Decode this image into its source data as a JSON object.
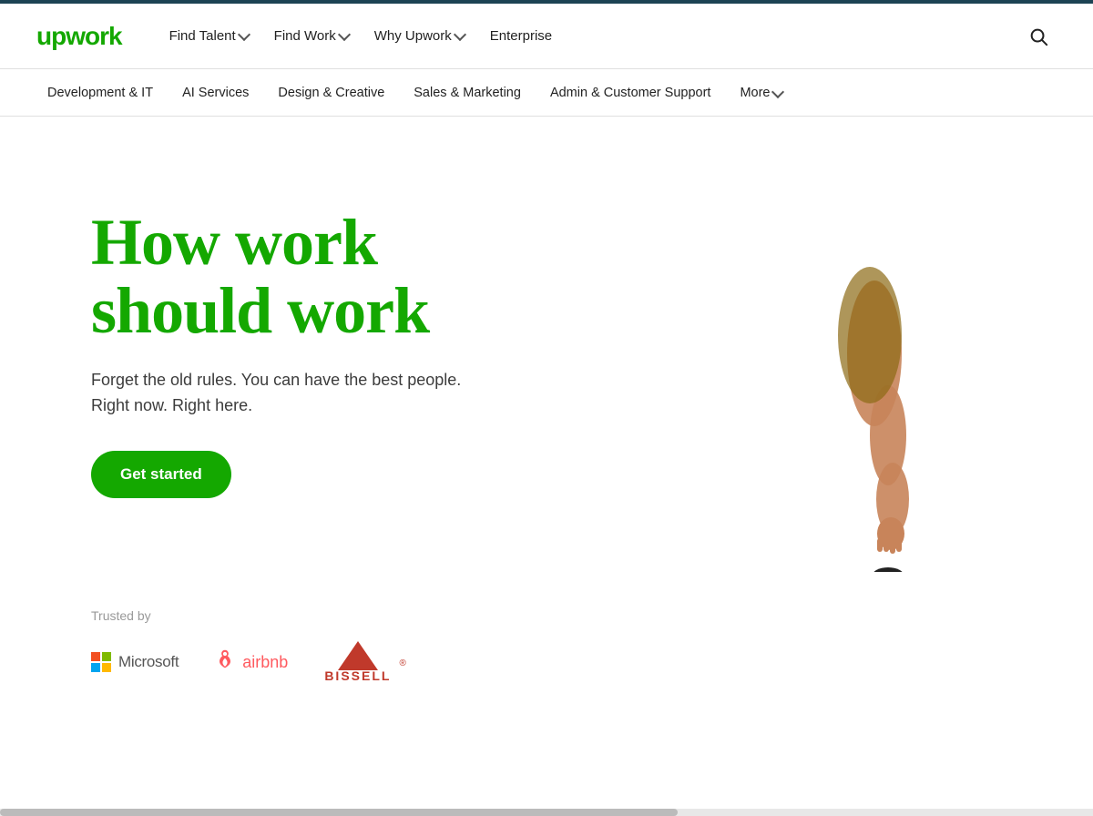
{
  "topbar": {},
  "main_nav": {
    "logo": "upwork",
    "links": [
      {
        "label": "Find Talent",
        "has_dropdown": true
      },
      {
        "label": "Find Work",
        "has_dropdown": true
      },
      {
        "label": "Why Upwork",
        "has_dropdown": true
      },
      {
        "label": "Enterprise",
        "has_dropdown": false
      }
    ]
  },
  "sub_nav": {
    "links": [
      {
        "label": "Development & IT"
      },
      {
        "label": "AI Services"
      },
      {
        "label": "Design & Creative"
      },
      {
        "label": "Sales & Marketing"
      },
      {
        "label": "Admin & Customer Support"
      },
      {
        "label": "More",
        "has_dropdown": true
      }
    ]
  },
  "hero": {
    "title": "How work\nshould work",
    "subtitle": "Forget the old rules. You can have the best people.\nRight now. Right here.",
    "cta_label": "Get started"
  },
  "trusted": {
    "label": "Trusted by",
    "logos": [
      {
        "name": "Microsoft"
      },
      {
        "name": "airbnb"
      },
      {
        "name": "Bissell"
      }
    ]
  },
  "search": {
    "aria_label": "Search"
  }
}
